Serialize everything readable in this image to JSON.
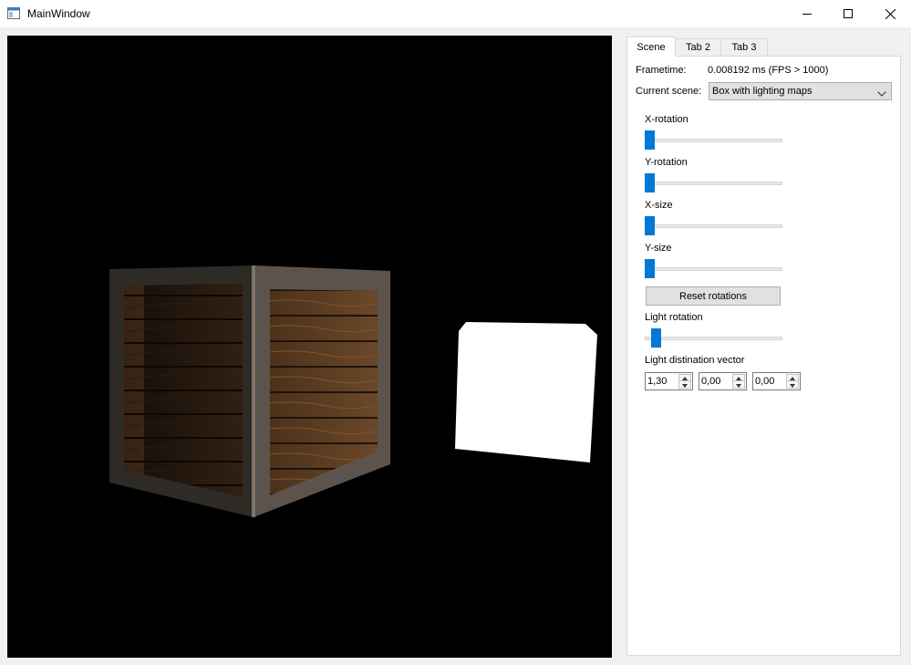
{
  "window": {
    "title": "MainWindow",
    "icons": {
      "app": "app-window-icon",
      "minimize": "minimize-icon",
      "maximize": "maximize-icon",
      "close": "close-icon"
    }
  },
  "tabs": [
    {
      "label": "Scene",
      "active": true
    },
    {
      "label": "Tab 2",
      "active": false
    },
    {
      "label": "Tab 3",
      "active": false
    }
  ],
  "scene_panel": {
    "frametime_label": "Frametime:",
    "frametime_value": "0.008192 ms (FPS > 1000)",
    "current_scene_label": "Current scene:",
    "current_scene_value": "Box with lighting maps",
    "sliders": [
      {
        "label": "X-rotation",
        "level": 0.0
      },
      {
        "label": "Y-rotation",
        "level": 0.0
      },
      {
        "label": "X-size",
        "level": 0.0
      },
      {
        "label": "Y-size",
        "level": 0.0
      }
    ],
    "reset_button": "Reset rotations",
    "light_rotation": {
      "label": "Light rotation",
      "level": 0.05
    },
    "light_vector": {
      "label": "Light distination vector",
      "values": [
        "1,30",
        "0,00",
        "0,00"
      ]
    }
  },
  "colors": {
    "accent": "#0078d7",
    "viewport_bg": "#000000",
    "panel_bg": "#ffffff",
    "window_bg": "#f0f0f0"
  }
}
